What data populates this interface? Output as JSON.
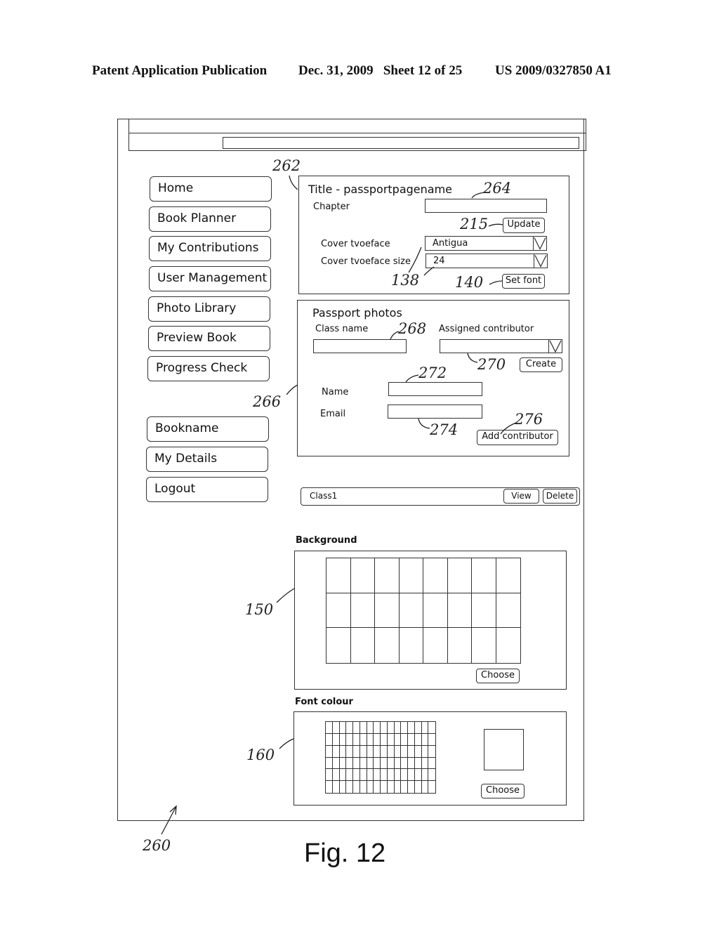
{
  "header": {
    "publication": "Patent Application Publication",
    "date_sheet": "Dec. 31, 2009   Sheet 12 of 25",
    "number": "US 2009/0327850 A1"
  },
  "window": {
    "address_bar_value": ""
  },
  "sidebar": {
    "primary_items": [
      {
        "label": "Home"
      },
      {
        "label": "Book Planner"
      },
      {
        "label": "My Contributions"
      },
      {
        "label": "User Management"
      },
      {
        "label": "Photo Library"
      },
      {
        "label": "Preview Book"
      },
      {
        "label": "Progress Check"
      }
    ],
    "secondary_items": [
      {
        "label": "Bookname"
      },
      {
        "label": "My Details"
      },
      {
        "label": "Logout"
      }
    ]
  },
  "title_panel": {
    "title": "Title - passportpagename",
    "chapter_label": "Chapter",
    "chapter_value": "",
    "update_button": "Update",
    "cover_typeface_label": "Cover tvoeface",
    "cover_typeface_value": "Antigua",
    "cover_typeface_size_label": "Cover tvoeface size",
    "cover_typeface_size_value": "24",
    "set_font_button": "Set font"
  },
  "passport_panel": {
    "title": "Passport photos",
    "class_name_label": "Class name",
    "class_name_value": "",
    "assigned_contributor_label": "Assigned contributor",
    "assigned_contributor_value": "",
    "create_button": "Create",
    "name_label": "Name",
    "name_value": "",
    "email_label": "Email",
    "email_value": "",
    "add_contributor_button": "Add contributor"
  },
  "class_list": [
    {
      "name": "Class1",
      "view_button": "View",
      "delete_button": "Delete"
    }
  ],
  "background_section": {
    "label": "Background",
    "grid_columns": 8,
    "grid_rows": 3,
    "choose_button": "Choose"
  },
  "font_colour_section": {
    "label": "Font colour",
    "grid_columns": 16,
    "grid_rows": 6,
    "choose_button": "Choose"
  },
  "reference_numerals": {
    "r262": "262",
    "r264": "264",
    "r215": "215",
    "r138": "138",
    "r140": "140",
    "r266": "266",
    "r268": "268",
    "r270": "270",
    "r272": "272",
    "r274": "274",
    "r276": "276",
    "r150": "150",
    "r160": "160",
    "r260": "260"
  },
  "figure_caption": "Fig. 12"
}
